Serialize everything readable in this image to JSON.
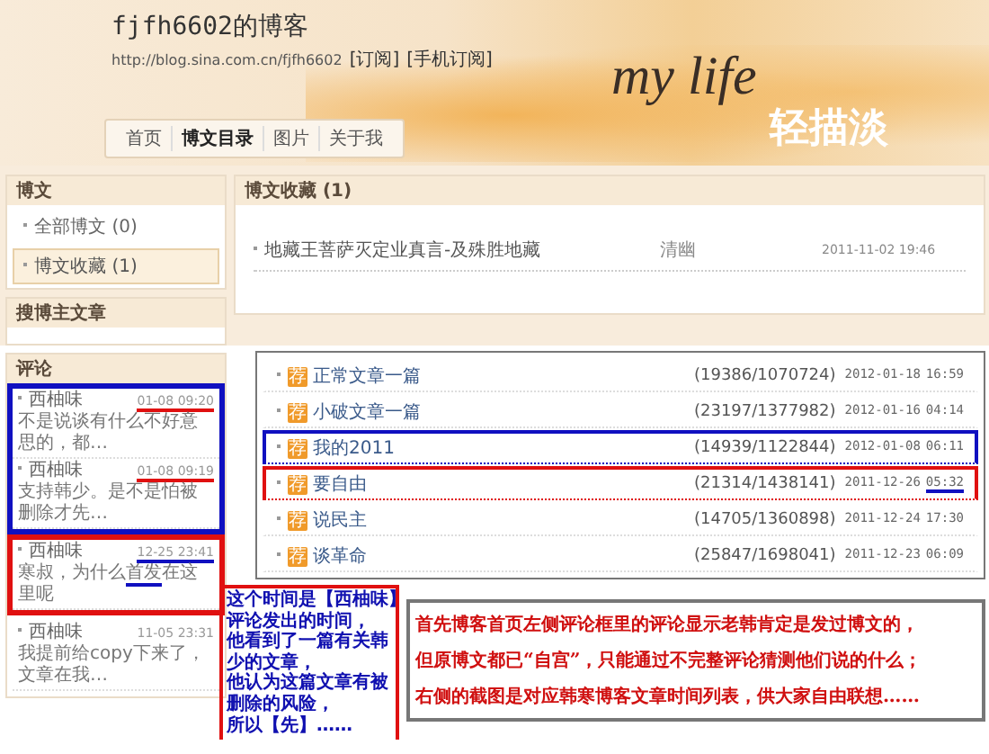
{
  "header": {
    "title": "fjfh6602的博客",
    "url": "http://blog.sina.com.cn/fjfh6602",
    "links": [
      "[订阅]",
      "[手机订阅]"
    ],
    "banner_text": "my life",
    "banner_subtext": "轻描淡"
  },
  "nav": [
    {
      "label": "首页",
      "selected": false
    },
    {
      "label": "博文目录",
      "selected": true
    },
    {
      "label": "图片",
      "selected": false
    },
    {
      "label": "关于我",
      "selected": false
    }
  ],
  "sidebar": {
    "blog_panel": {
      "title": "博文",
      "items": [
        {
          "label": "全部博文",
          "count": "(0)",
          "selected": false
        },
        {
          "label": "博文收藏",
          "count": "(1)",
          "selected": true
        }
      ]
    },
    "search_panel": {
      "title": "搜博主文章"
    },
    "comments_panel": {
      "title": "评论",
      "groups": [
        {
          "highlighted": true,
          "color": "#1010c0",
          "comments": [
            {
              "author": "西柚味",
              "time": "01-08 09:20",
              "time_underlined": true,
              "color": "#e01010",
              "text": [
                {
                  "t": "不是说谈有什么不好意思的，都…",
                  "underline": false
                }
              ]
            },
            {
              "author": "西柚味",
              "time": "01-08 09:19",
              "time_underlined": true,
              "color": "#e01010",
              "text": [
                {
                  "t": "支持韩少。是不是怕被删除才先…",
                  "underline": false
                }
              ]
            }
          ]
        },
        {
          "highlighted": true,
          "color": "#e01010",
          "comments": [
            {
              "author": "西柚味",
              "time": "12-25 23:41",
              "time_underlined": true,
              "color": "#1010c0",
              "text": [
                {
                  "t": "寒叔，为什么",
                  "underline": false
                },
                {
                  "t": "首发",
                  "underline": true
                },
                {
                  "t": "在这里呢",
                  "underline": false
                }
              ]
            }
          ]
        },
        {
          "highlighted": false,
          "comments": [
            {
              "author": "西柚味",
              "time": "11-05 23:31",
              "time_underlined": false,
              "text": [
                {
                  "t": "我提前给copy下来了，文章在我…",
                  "underline": false
                }
              ]
            }
          ]
        }
      ]
    }
  },
  "favorites": {
    "title": "博文收藏 (1)",
    "rows": [
      {
        "title": "地藏王菩萨灭定业真言-及殊胜地藏",
        "author": "清幽",
        "date": "2011-11-02 19:46"
      }
    ]
  },
  "articles": [
    {
      "badge": "荐",
      "title": "正常文章一篇",
      "stats": "(19386/1070724)",
      "date": "2012-01-18",
      "time": "16:59",
      "highlighted": false,
      "time_underlined": false
    },
    {
      "badge": "荐",
      "title": "小破文章一篇",
      "stats": "(23197/1377982)",
      "date": "2012-01-16",
      "time": "04:14",
      "highlighted": false,
      "time_underlined": false
    },
    {
      "badge": "荐",
      "title": "我的2011",
      "stats": "(14939/1122844)",
      "date": "2012-01-08",
      "time": "06:11",
      "highlighted": true,
      "color": "#1010c0",
      "time_underlined": false
    },
    {
      "badge": "荐",
      "title": "要自由",
      "stats": "(21314/1438141)",
      "date": "2011-12-26",
      "time": "05:32",
      "highlighted": true,
      "color": "#e01010",
      "time_underlined": true
    },
    {
      "badge": "荐",
      "title": "说民主",
      "stats": "(14705/1360898)",
      "date": "2011-12-24",
      "time": "17:30",
      "highlighted": false,
      "time_underlined": false
    },
    {
      "badge": "荐",
      "title": "谈革命",
      "stats": "(25847/1698041)",
      "date": "2011-12-23",
      "time": "06:09",
      "highlighted": false,
      "time_underlined": false
    }
  ],
  "notes": [
    {
      "kind": "side",
      "lines": [
        "这个时间是【西柚味】",
        "评论发出的时间，",
        "他看到了一篇有关韩",
        "少的文章，",
        "他认为这篇文章有被",
        "删除的风险，",
        "所以【先】……"
      ]
    },
    {
      "kind": "main",
      "lines": [
        "首先博客首页左侧评论框里的评论显示老韩肯定是发过博文的，",
        "但原博文都已“自宫”，只能通过不完整评论猜测他们说的什么；",
        "右侧的截图是对应韩寒博客文章时间列表，供大家自由联想……"
      ]
    }
  ]
}
